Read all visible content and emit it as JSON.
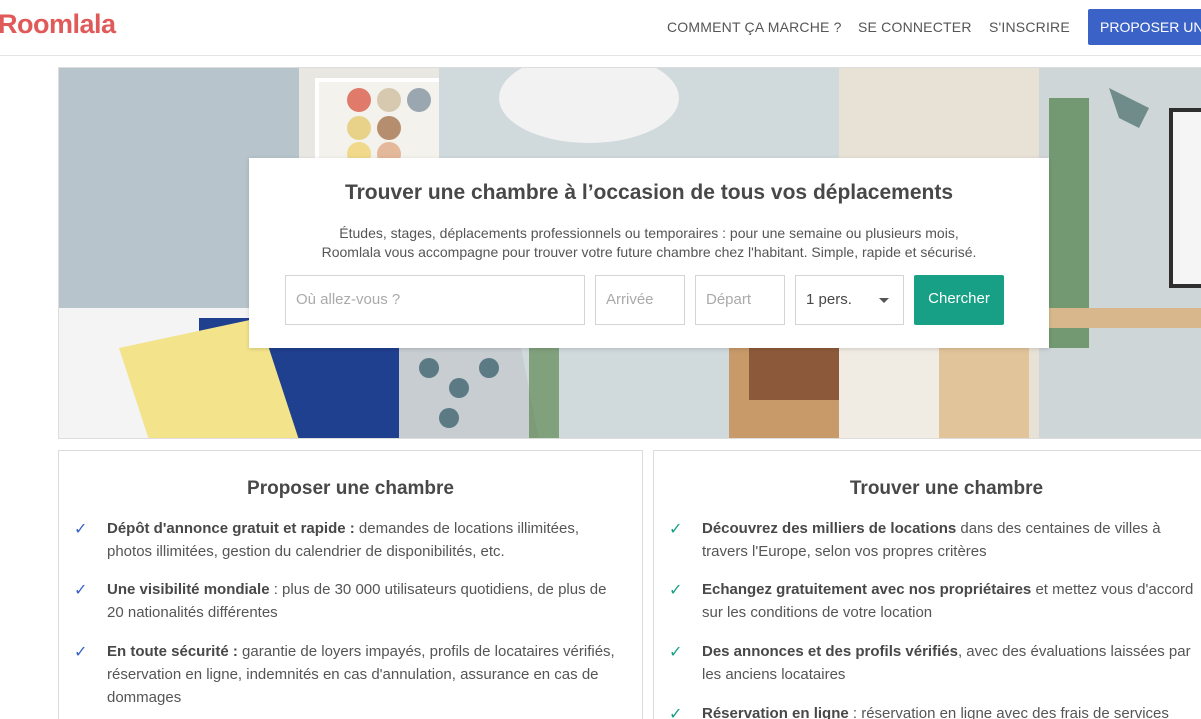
{
  "header": {
    "logo": "Roomlala",
    "nav": {
      "how": "COMMENT ÇA MARCHE ?",
      "login": "SE CONNECTER",
      "signup": "S'INSCRIRE",
      "cta": "PROPOSER UNE CHAMBRE"
    }
  },
  "hero": {
    "title": "Trouver une chambre à l’occasion de tous vos déplacements",
    "subtitle_line1": "Études, stages, déplacements professionnels ou temporaires : pour une semaine ou plusieurs mois,",
    "subtitle_line2": "Roomlala vous accompagne pour trouver votre future chambre chez l'habitant. Simple, rapide et sécurisé.",
    "search": {
      "where_placeholder": "Où allez-vous ?",
      "arrival_placeholder": "Arrivée",
      "departure_placeholder": "Départ",
      "persons_value": "1 pers.",
      "button": "Chercher"
    }
  },
  "propose": {
    "title": "Proposer une chambre",
    "items": [
      {
        "bold": "Dépôt d'annonce gratuit et rapide :",
        "text": " demandes de locations illimitées, photos illimitées, gestion du calendrier de disponibilités, etc."
      },
      {
        "bold": "Une visibilité mondiale",
        "text": " : plus de 30 000 utilisateurs quotidiens, de plus de 20 nationalités différentes"
      },
      {
        "bold": "En toute sécurité :",
        "text": " garantie de loyers impayés, profils de locataires vérifiés, réservation en ligne, indemnités en cas d'annulation, assurance en cas de dommages"
      }
    ]
  },
  "find": {
    "title": "Trouver une chambre",
    "items": [
      {
        "bold": "Découvrez des milliers de locations",
        "text": " dans des centaines de villes à travers l'Europe, selon vos propres critères"
      },
      {
        "bold": "Echangez gratuitement avec nos propriétaires",
        "text": " et mettez vous d'accord sur les conditions de votre location"
      },
      {
        "bold": "Des annonces et des profils vérifiés",
        "text": ", avec des évaluations laissées par les anciens locataires"
      },
      {
        "bold": "Réservation en ligne",
        "text": " : réservation en ligne avec des frais de services"
      }
    ]
  },
  "icons": {
    "check": "✓"
  },
  "colors": {
    "brand": "#e05a5a",
    "cta": "#3a62c7",
    "search_button": "#17a085"
  }
}
